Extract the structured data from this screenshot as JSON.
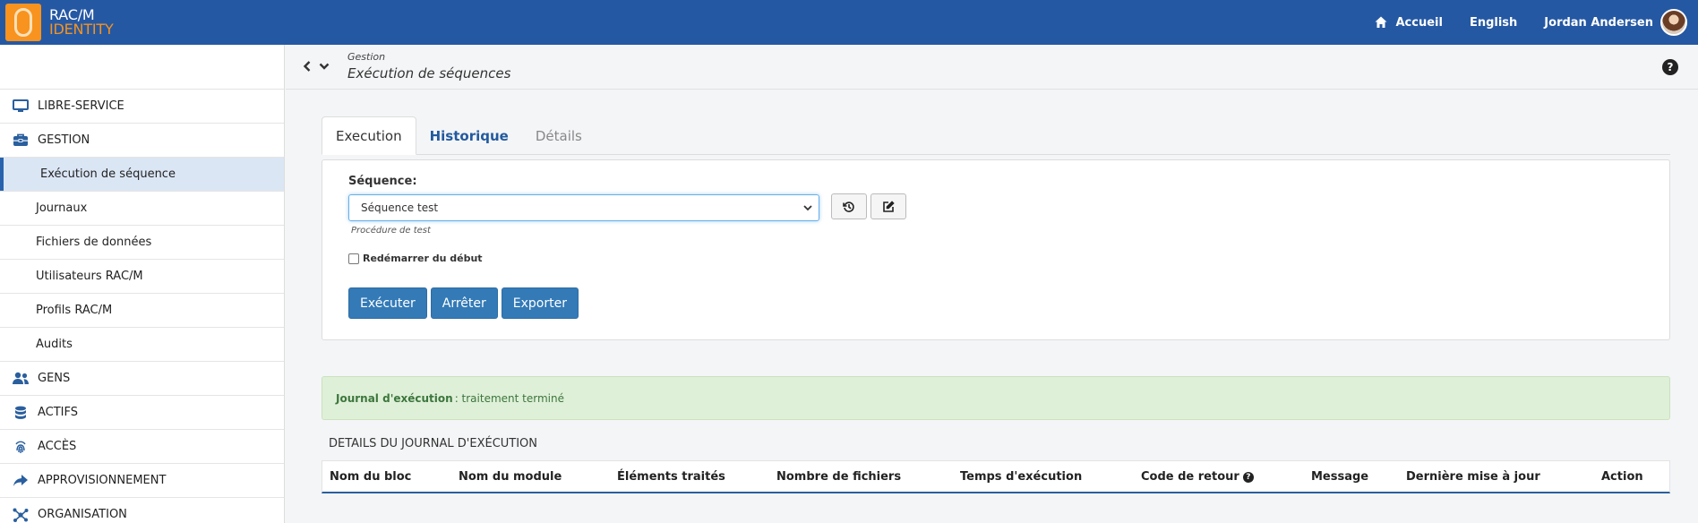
{
  "brand": {
    "line1": "RAC/M",
    "line2": "IDENTITY"
  },
  "topnav": {
    "home": "Accueil",
    "language": "English",
    "user": "Jordan Andersen"
  },
  "sidebar": {
    "items": [
      {
        "label": "LIBRE-SERVICE",
        "icon": "monitor-icon",
        "type": "section"
      },
      {
        "label": "GESTION",
        "icon": "toolbox-icon",
        "type": "section"
      },
      {
        "label": "Exécution de séquence",
        "type": "active"
      },
      {
        "label": "Journaux",
        "type": "sub"
      },
      {
        "label": "Fichiers de données",
        "type": "sub"
      },
      {
        "label": "Utilisateurs RAC/M",
        "type": "sub"
      },
      {
        "label": "Profils RAC/M",
        "type": "sub"
      },
      {
        "label": "Audits",
        "type": "sub"
      },
      {
        "label": "GENS",
        "icon": "users-icon",
        "type": "section"
      },
      {
        "label": "ACTIFS",
        "icon": "database-icon",
        "type": "section"
      },
      {
        "label": "ACCÈS",
        "icon": "fingerprint-icon",
        "type": "section"
      },
      {
        "label": "APPROVISIONNEMENT",
        "icon": "share-icon",
        "type": "section"
      },
      {
        "label": "ORGANISATION",
        "icon": "network-icon",
        "type": "section"
      }
    ]
  },
  "breadcrumb": {
    "parent": "Gestion",
    "title": "Exécution de séquences"
  },
  "tabs": [
    "Execution",
    "Historique",
    "Détails"
  ],
  "form": {
    "sequence_label": "Séquence:",
    "sequence_value": "Séquence test",
    "sequence_hint": "Procédure de test",
    "restart_label": "Redémarrer du début",
    "restart_checked": false
  },
  "actions": {
    "execute": "Exécuter",
    "stop": "Arrêter",
    "export": "Exporter"
  },
  "alert": {
    "label": "Journal d'exécution",
    "text": ": traitement terminé"
  },
  "details": {
    "title": "DETAILS DU JOURNAL D'EXÉCUTION",
    "columns": [
      "Nom du bloc",
      "Nom du module",
      "Éléments traités",
      "Nombre de fichiers",
      "Temps d'exécution",
      "Code de retour",
      "Message",
      "Dernière mise à jour",
      "Action"
    ]
  },
  "colors": {
    "topbar": "#2558a3",
    "accent": "#337ab7",
    "brand_orange": "#f7931e",
    "alert_bg": "#dff0d8"
  }
}
